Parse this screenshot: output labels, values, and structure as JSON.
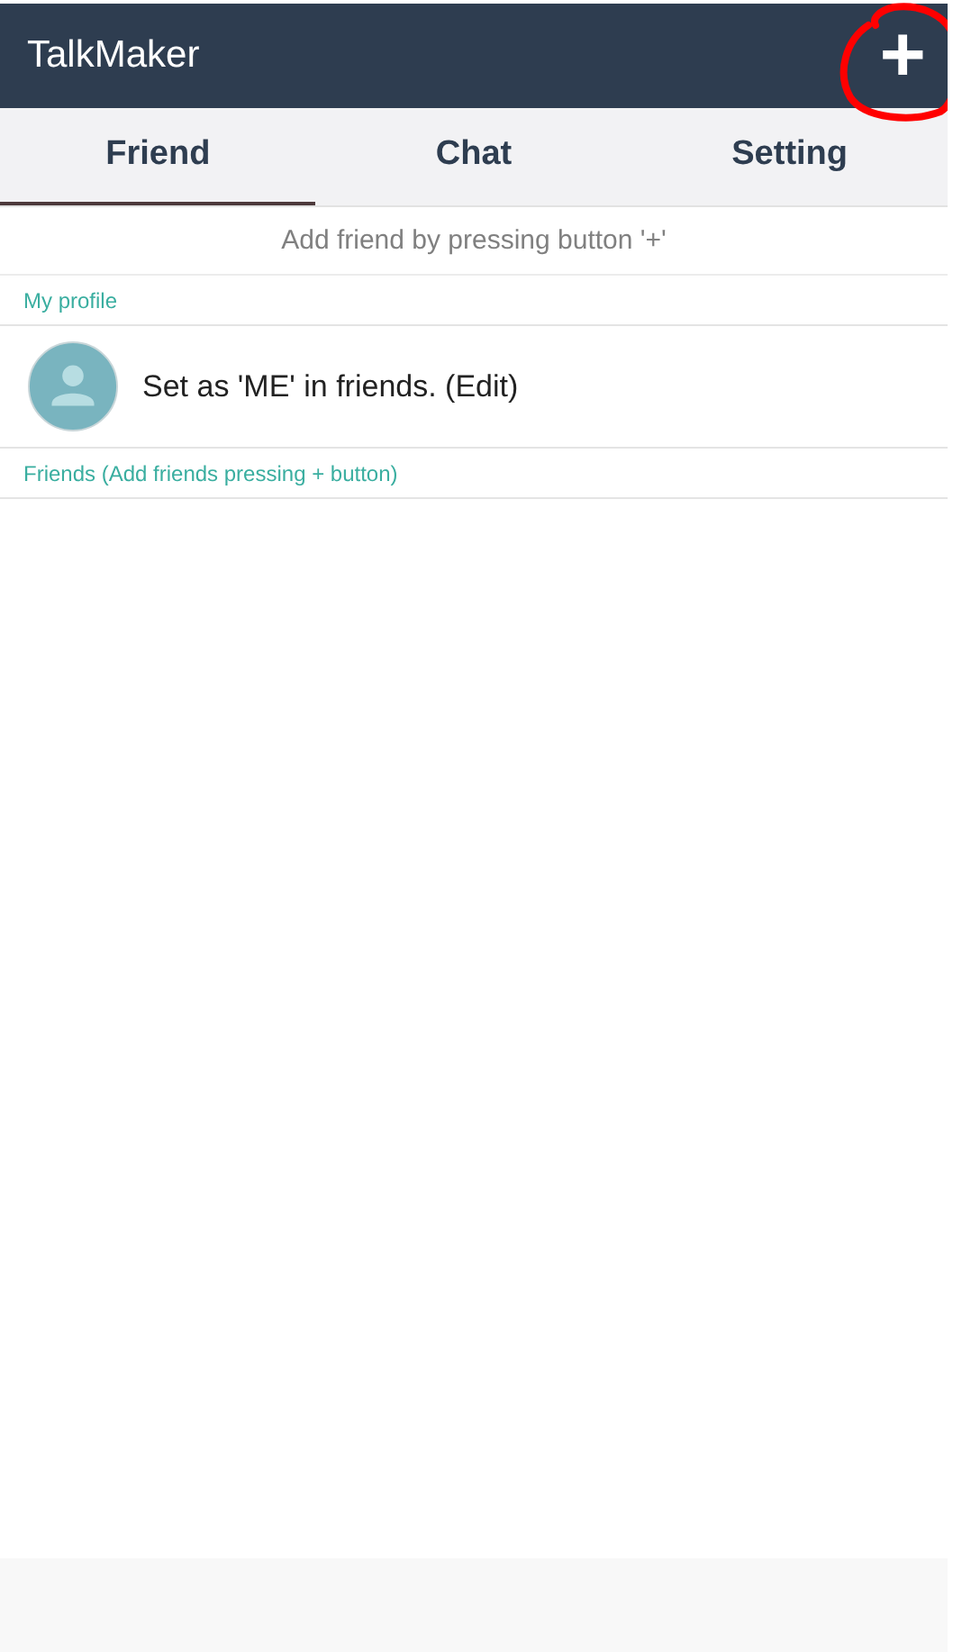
{
  "app_bar": {
    "title": "TalkMaker",
    "action": "+"
  },
  "annotation": {
    "kind": "circle"
  },
  "tabs": [
    {
      "label": "Friend",
      "selected": true
    },
    {
      "label": "Chat",
      "selected": false
    },
    {
      "label": "Setting",
      "selected": false
    }
  ],
  "hint": "Add friend by pressing button '+'",
  "sections": [
    {
      "header": "My profile",
      "items": [
        {
          "text": "Set as 'ME' in friends. (Edit)"
        }
      ]
    },
    {
      "header": "Friends (Add friends pressing + button)"
    }
  ]
}
